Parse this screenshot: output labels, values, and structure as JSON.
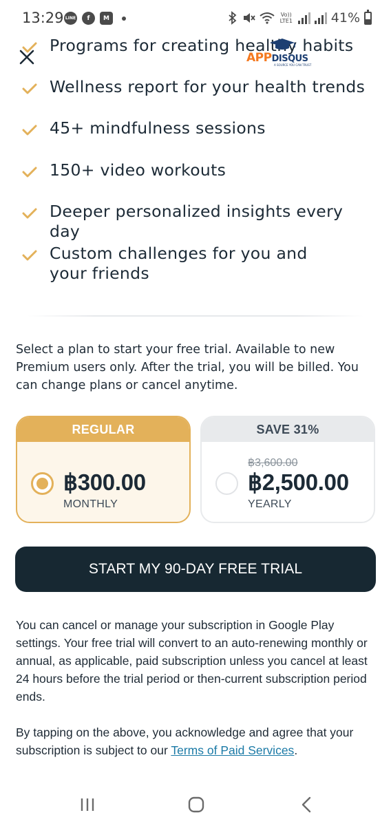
{
  "status_bar": {
    "time": "13:29",
    "notification_icons": [
      "line-app-icon",
      "facebook-icon",
      "gmail-icon",
      "more-dot-icon"
    ],
    "line_label": "LINE",
    "system_icons": [
      "bluetooth-icon",
      "mute-icon",
      "wifi-icon",
      "volte-icon",
      "signal-icon",
      "signal-icon",
      "battery-icon"
    ],
    "volte_label": "Vo)) LTE1",
    "battery": "41%"
  },
  "watermark": {
    "brand_primary": "APP",
    "brand_secondary": "DISQUS",
    "tagline": "A SOURCE YOU CAN TRUST"
  },
  "features": [
    "Programs for creating healthy habits",
    "Wellness report for your health trends",
    "45+ mindfulness sessions",
    "150+ video workouts",
    "Deeper personalized insights every day",
    "Custom challenges for you and your friends"
  ],
  "plan_description": "Select a plan to start your free trial. Available to new Premium users only. After the trial, you will be billed. You can change plans or cancel anytime.",
  "plans": [
    {
      "header": "REGULAR",
      "price": "฿300.00",
      "period": "MONTHLY",
      "selected": true
    },
    {
      "header": "SAVE 31%",
      "old_price": "฿3,600.00",
      "price": "฿2,500.00",
      "period": "YEARLY",
      "selected": false
    }
  ],
  "cta_label": "START MY 90-DAY FREE TRIAL",
  "legal_text": "You can cancel or manage your subscription in Google Play settings. Your free trial will convert to an auto-renewing monthly or annual, as applicable, paid subscription unless you cancel at least 24 hours before the trial period or then-current subscription period ends.",
  "agreement": {
    "prefix": "By tapping on the above, you acknowledge and agree that your subscription is subject to our ",
    "link": "Terms of Paid Services",
    "suffix": "."
  },
  "colors": {
    "accent_gold": "#e3b15a",
    "cta_dark": "#172832",
    "link": "#1b7aa6",
    "text": "#1c2a36"
  },
  "nav_bar": [
    "recents-icon",
    "home-icon",
    "back-icon"
  ]
}
